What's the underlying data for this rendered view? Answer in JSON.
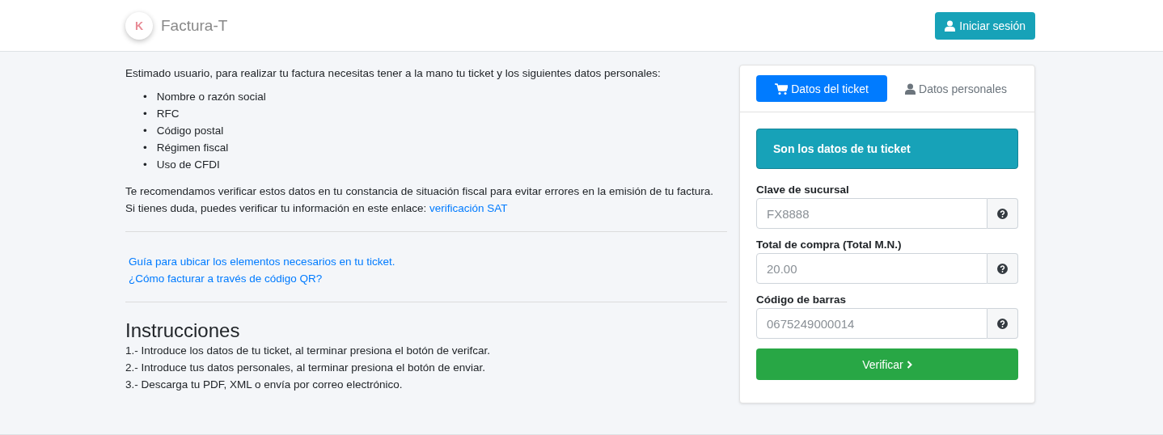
{
  "header": {
    "logo_letter": "K",
    "brand": "Factura-T",
    "login_button": "Iniciar sesión"
  },
  "intro": {
    "text": "Estimado usuario, para realizar tu factura necesitas tener a la mano tu ticket y los siguientes datos personales:",
    "bullet": "•",
    "items": [
      "Nombre o razón social",
      "RFC",
      "Código postal",
      "Régimen fiscal",
      "Uso de CFDI"
    ],
    "recommend": "Te recomendamos verificar estos datos en tu constancia de situación fiscal para evitar errores en la emisión de tu factura.",
    "doubt": "Si tienes duda, puedes verificar tu información en este enlace:",
    "doubt_link": "verificación SAT"
  },
  "guide_links": [
    "Guía para ubicar los elementos necesarios en tu ticket.",
    "¿Cómo facturar a través de código QR?"
  ],
  "instructions": {
    "title": "Instrucciones",
    "steps": [
      "1.- Introduce los datos de tu ticket, al terminar presiona el botón de verifcar.",
      "2.- Introduce tus datos personales, al terminar presiona el botón de enviar.",
      "3.- Descarga tu PDF, XML o envía por correo electrónico."
    ]
  },
  "form": {
    "tabs": [
      {
        "label": "Datos del ticket",
        "kind": "cart",
        "selected": true
      },
      {
        "label": "Datos personales",
        "kind": "user",
        "selected": false
      }
    ],
    "banner": "Son los datos de tu ticket",
    "fields": [
      {
        "label": "Clave de sucursal",
        "placeholder": "FX8888"
      },
      {
        "label": "Total de compra (Total M.N.)",
        "placeholder": "20.00"
      },
      {
        "label": "Código de barras",
        "placeholder": "0675249000014"
      }
    ],
    "submit": "Verificar"
  }
}
